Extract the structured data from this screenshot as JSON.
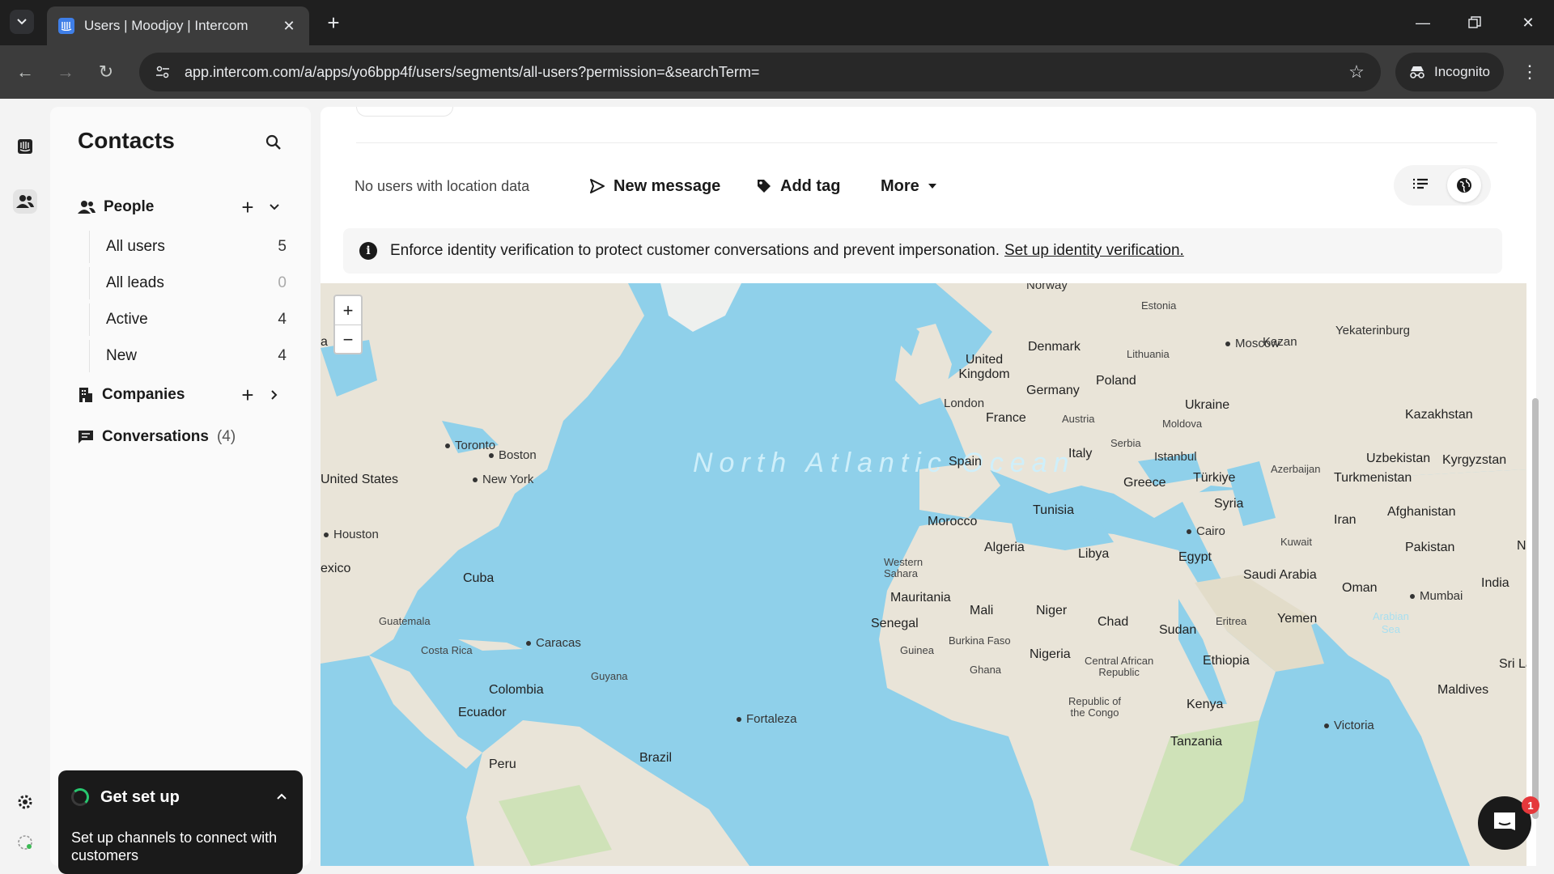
{
  "browser": {
    "tab_title": "Users | Moodjoy | Intercom",
    "url": "app.intercom.com/a/apps/yo6bpp4f/users/segments/all-users?permission=&searchTerm=",
    "incognito_label": "Incognito"
  },
  "sidebar": {
    "title": "Contacts",
    "people_label": "People",
    "items": [
      {
        "label": "All users",
        "count": "5"
      },
      {
        "label": "All leads",
        "count": "0"
      },
      {
        "label": "Active",
        "count": "4"
      },
      {
        "label": "New",
        "count": "4"
      }
    ],
    "companies_label": "Companies",
    "conversations_label": "Conversations",
    "conversations_count": "(4)"
  },
  "get_set_up": {
    "title": "Get set up",
    "text": "Set up channels to connect with customers"
  },
  "main": {
    "no_location": "No users with location data",
    "new_message": "New message",
    "add_tag": "Add tag",
    "more": "More"
  },
  "banner": {
    "text": "Enforce identity verification to protect customer conversations and prevent impersonation.",
    "link": "Set up identity verification."
  },
  "map": {
    "zoom_in": "+",
    "zoom_out": "−",
    "ocean": "North Atlantic Ocean",
    "labels": {
      "norway": "Norway",
      "estonia": "Estonia",
      "uk": "United Kingdom",
      "denmark": "Denmark",
      "lithuania": "Lithuania",
      "moscow": "Moscow",
      "kazan": "Kazan",
      "yekaterinburg": "Yekaterinburg",
      "london": "London",
      "germany": "Germany",
      "poland": "Poland",
      "ukraine": "Ukraine",
      "moldova": "Moldova",
      "france": "France",
      "austria": "Austria",
      "kazakhstan": "Kazakhstan",
      "serbia": "Serbia",
      "spain": "Spain",
      "italy": "Italy",
      "istanbul": "Istanbul",
      "uzbekistan": "Uzbekistan",
      "kyrgyzstan": "Kyrgyzstan",
      "azerbaijan": "Azerbaijan",
      "turkmenistan": "Turkmenistan",
      "greece": "Greece",
      "turkiye": "Türkiye",
      "tunisia": "Tunisia",
      "syria": "Syria",
      "afghanistan": "Afghanistan",
      "morocco": "Morocco",
      "iran": "Iran",
      "cairo": "Cairo",
      "kuwait": "Kuwait",
      "algeria": "Algeria",
      "libya": "Libya",
      "egypt": "Egypt",
      "pakistan": "Pakistan",
      "western_sahara": "Western\nSahara",
      "saudi": "Saudi Arabia",
      "india": "India",
      "oman": "Oman",
      "mumbai": "Mumbai",
      "mauritania": "Mauritania",
      "mali": "Mali",
      "niger": "Niger",
      "chad": "Chad",
      "yemen": "Yemen",
      "senegal": "Senegal",
      "eritrea": "Eritrea",
      "sudan": "Sudan",
      "arabian_sea": "Arabian\nSea",
      "burkina": "Burkina Faso",
      "guinea": "Guinea",
      "nigeria": "Nigeria",
      "ethiopia": "Ethiopia",
      "ghana": "Ghana",
      "car": "Central African\nRepublic",
      "sri_lanka": "Sri Lan",
      "maldives": "Maldives",
      "roc": "Republic of\nthe Congo",
      "kenya": "Kenya",
      "victoria": "Victoria",
      "tanzania": "Tanzania",
      "toronto": "Toronto",
      "boston": "Boston",
      "new_york": "New York",
      "united_states": "United States",
      "houston": "Houston",
      "mexico": "exico",
      "cuba": "Cuba",
      "guatemala": "Guatemala",
      "costa_rica": "Costa Rica",
      "caracas": "Caracas",
      "guyana": "Guyana",
      "colombia": "Colombia",
      "ecuador": "Ecuador",
      "fortaleza": "Fortaleza",
      "brazil": "Brazil",
      "peru": "Peru",
      "a": "a",
      "n": "N"
    }
  },
  "messenger_badge": "1"
}
